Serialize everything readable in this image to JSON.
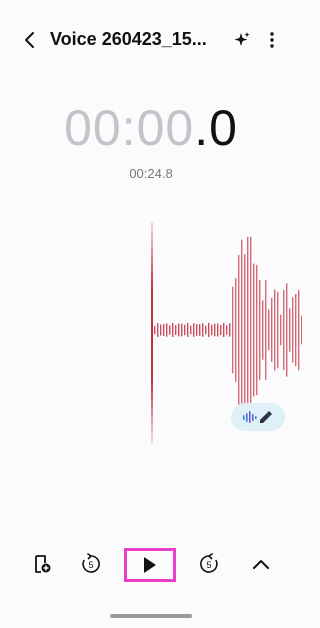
{
  "header": {
    "title": "Voice 260423_15...",
    "back_icon": "chevron-left-icon",
    "ai_icon": "sparkle-icon",
    "more_icon": "more-vertical-icon"
  },
  "timer": {
    "dim_part": "00:00",
    "bright_part": ".0"
  },
  "duration": "00:24.8",
  "colors": {
    "waveform": "#c22e3c",
    "highlight": "#e83ec9",
    "transcribe_bg": "#dff0f6"
  },
  "controls": {
    "bookmark_icon": "add-bookmark-icon",
    "rewind_icon": "rewind-5-icon",
    "rewind_label": "5",
    "play_icon": "play-icon",
    "forward_icon": "forward-5-icon",
    "forward_label": "5",
    "expand_icon": "chevron-up-icon"
  }
}
